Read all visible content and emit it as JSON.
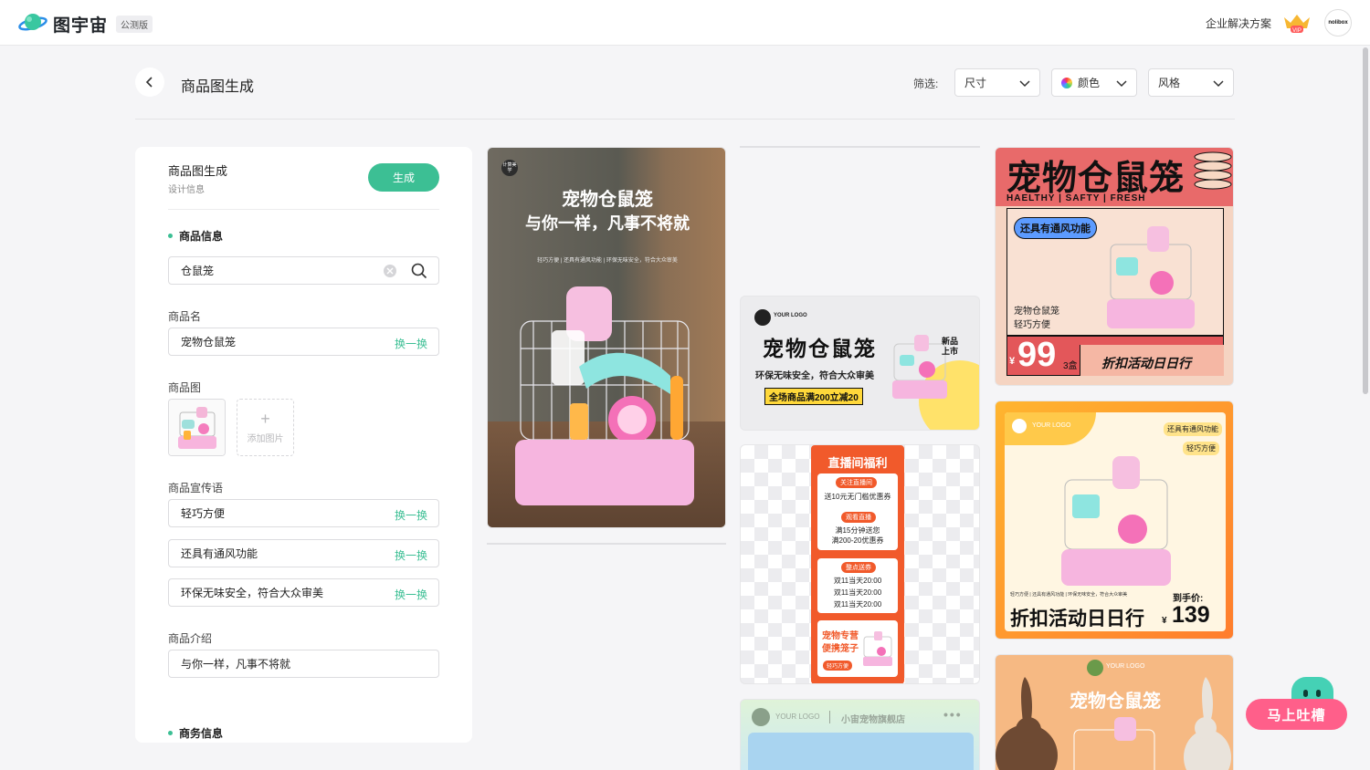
{
  "app": {
    "logo_text": "图宇宙",
    "beta_badge": "公测版",
    "enterprise_link": "企业解决方案",
    "vip_label": "VIP",
    "avatar_text": "nolibox"
  },
  "header": {
    "title": "商品图生成",
    "filter_label": "筛选:",
    "filters": [
      {
        "label": "尺寸",
        "selected": "尺寸"
      },
      {
        "label": "颜色",
        "selected": "颜色"
      },
      {
        "label": "风格",
        "selected": "风格"
      }
    ]
  },
  "panel": {
    "title": "商品图生成",
    "subtitle": "设计信息",
    "generate_label": "生成",
    "section_product": "商品信息",
    "search_value": "仓鼠笼",
    "name_label": "商品名",
    "name_value": "宠物仓鼠笼",
    "swap_label": "换一换",
    "image_label": "商品图",
    "add_image_label": "添加图片",
    "slogan_label": "商品宣传语",
    "slogans": [
      "轻巧方便",
      "还具有通风功能",
      "环保无味安全，符合大众审美"
    ],
    "intro_label": "商品介绍",
    "intro_value": "与你一样，凡事不将就",
    "section_business": "商务信息"
  },
  "cards": {
    "card1": {
      "badge": "计算美学",
      "title1": "宠物仓鼠笼",
      "title2": "与你一样，凡事不将就",
      "tagline": "轻巧方便 | 还具有通风功能 | 环保无味安全，符合大众审美"
    },
    "card2": {
      "logo": "YOUR LOGO",
      "title": "宠物仓鼠笼",
      "subtitle": "环保无味安全，符合大众审美",
      "promo": "全场商品满200立减20",
      "burst": "新品上市"
    },
    "card3": {
      "header": "直播间福利",
      "tag1": "关注直播间",
      "text1": "送10元无门槛优惠券",
      "tag2": "观看直播",
      "text2a": "满15分钟送您",
      "text2b": "满200-20优惠券",
      "tag3": "整点送券",
      "times": [
        "双11当天20:00",
        "双11当天20:00",
        "双11当天20:00"
      ],
      "promo1": "宠物专营",
      "promo2": "便携笼子",
      "promo_tag": "轻巧方便"
    },
    "card4": {
      "logo": "YOUR LOGO",
      "store": "小宙宠物旗舰店"
    },
    "card5": {
      "title": "宠物仓鼠笼",
      "tagline": "HAELTHY | SAFTY | FRESH",
      "bubble": "还具有通风功能",
      "text1": "宠物仓鼠笼",
      "text2": "轻巧方便",
      "price": "99",
      "currency": "¥",
      "unit": "3盒",
      "sale": "折扣活动日日行"
    },
    "card6": {
      "logo": "YOUR LOGO",
      "tag1": "还具有通风功能",
      "tag2": "轻巧方便",
      "small": "轻巧方便 | 还具有通风功能 | 环保无味安全，符合大众审美",
      "sale": "折扣活动日日行",
      "price_label": "到手价:",
      "currency": "¥",
      "price": "139"
    },
    "card7": {
      "logo": "YOUR LOGO",
      "title": "宠物仓鼠笼"
    }
  },
  "feedback": {
    "label": "马上吐槽"
  },
  "colors": {
    "accent": "#3cbf94",
    "feedback": "#ff5f8a"
  }
}
